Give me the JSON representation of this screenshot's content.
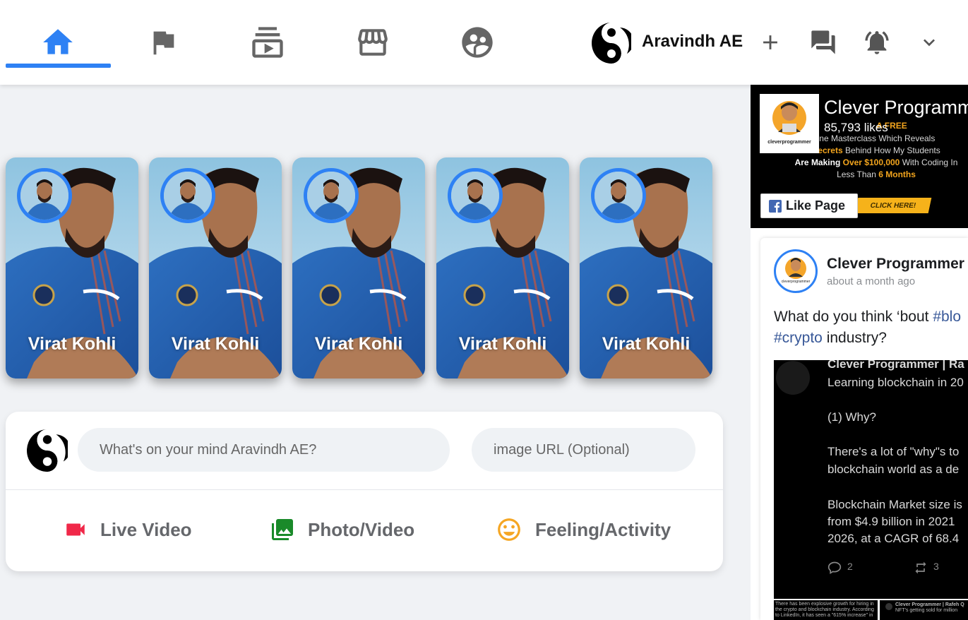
{
  "colors": {
    "accent": "#2e81f4",
    "live_video": "#f02849",
    "photo": "#1a8a2a",
    "feeling": "#f5a623",
    "icon_gray": "#666666"
  },
  "header": {
    "nav": [
      {
        "icon": "home-icon",
        "active": true
      },
      {
        "icon": "flag-icon",
        "active": false
      },
      {
        "icon": "subscriptions-icon",
        "active": false
      },
      {
        "icon": "storefront-icon",
        "active": false
      },
      {
        "icon": "supervised-user-icon",
        "active": false
      }
    ],
    "user_name": "Aravindh AE",
    "actions": [
      "add-icon",
      "forum-icon",
      "notifications-active-icon",
      "expand-more-icon"
    ]
  },
  "stories": [
    {
      "name": "Virat Kohli"
    },
    {
      "name": "Virat Kohli"
    },
    {
      "name": "Virat Kohli"
    },
    {
      "name": "Virat Kohli"
    },
    {
      "name": "Virat Kohli"
    }
  ],
  "sender": {
    "message_placeholder": "What's on your mind Aravindh AE?",
    "image_placeholder": "image URL (Optional)",
    "options": {
      "live_video": "Live Video",
      "photo_video": "Photo/Video",
      "feeling": "Feeling/Activity"
    }
  },
  "sidebar": {
    "page_plugin": {
      "title": "Clever Programmer",
      "likes": "85,793 likes",
      "like_button": "Like Page",
      "logo_text": "cleverprogrammer",
      "promo": {
        "line1a": "A FREE",
        "line2": "ine Masterclass Which Reveals",
        "line3a": "Secrets",
        "line3b": " Behind How My Students",
        "line4a": "Are Making ",
        "line4b": "Over $100,000",
        "line4c": " With Coding In",
        "line5a": "Less Than ",
        "line5b": "6 Months",
        "cta": "CLICK HERE!"
      }
    },
    "post": {
      "author": "Clever Programmer",
      "time": "about a month ago",
      "text_before": "What do you think ‘bout ",
      "tag1": "#blo",
      "tag2": "#crypto",
      "text_after": " industry?",
      "tweet": {
        "header": "Clever Programmer | Ra",
        "l1": "Learning blockchain in 20",
        "l2": "(1) Why?",
        "l3": "There's a lot of \"why\"s to",
        "l4": "blockchain world as a de",
        "l5": "Blockchain Market size is",
        "l6": "from $4.9 billion in 2021",
        "l7": "2026, at a CAGR of 68.4",
        "replies": "2",
        "retweets": "3"
      },
      "thumbs": {
        "a1": "There has been explosive growth for hiring in",
        "a2": "the crypto and blockchain industry. According",
        "a3": "to LinkedIn, it has seen a \"615% increase\" in",
        "b1": "Clever Programmer | Rafeh Q",
        "b2": "NFT's getting sold for million"
      }
    }
  }
}
